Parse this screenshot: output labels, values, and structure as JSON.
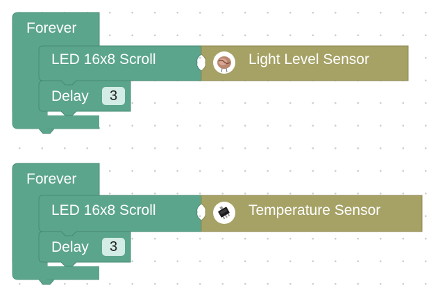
{
  "blocks": [
    {
      "loop_label": "Forever",
      "action_label": "LED 16x8 Scroll",
      "sensor_label": "Light Level Sensor",
      "sensor_icon": "light-sensor-icon",
      "delay_label": "Delay",
      "delay_value": "3"
    },
    {
      "loop_label": "Forever",
      "action_label": "LED 16x8 Scroll",
      "sensor_label": "Temperature Sensor",
      "sensor_icon": "temperature-sensor-icon",
      "delay_label": "Delay",
      "delay_value": "3"
    }
  ],
  "colors": {
    "block_green": "#5ba58c",
    "block_green_dark": "#478a74",
    "sensor_olive": "#a6a266",
    "sensor_olive_dark": "#8c8850",
    "field_bg": "#d3ece5"
  }
}
